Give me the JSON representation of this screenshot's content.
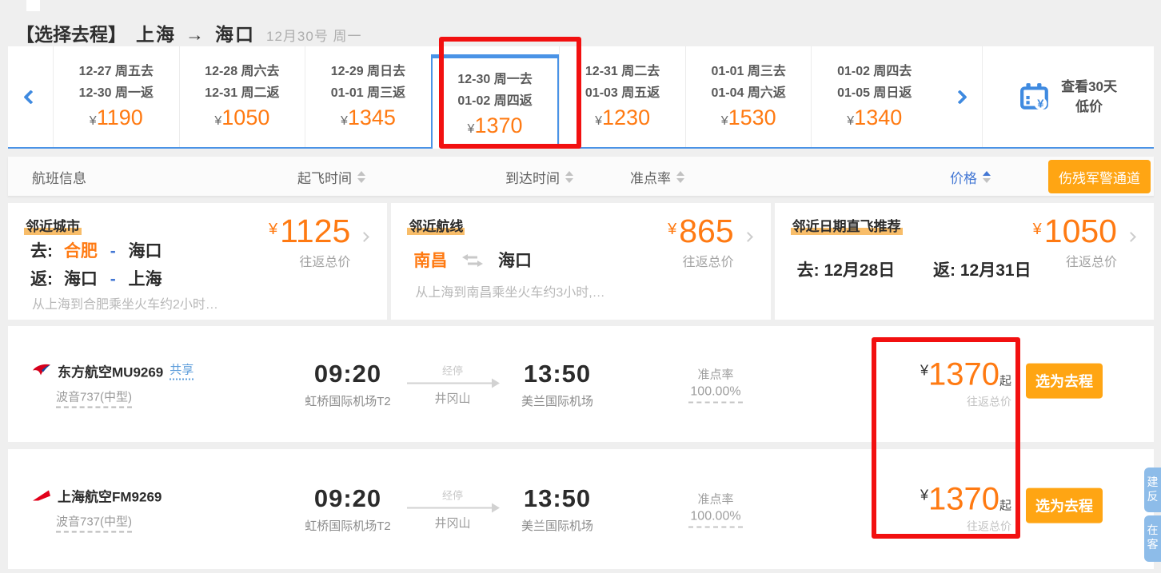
{
  "header": {
    "select_label": "【选择去程】",
    "from_city": "上海",
    "arrow": "→",
    "to_city": "海口",
    "date_info": "12月30号 周一"
  },
  "carousel": {
    "cards": [
      {
        "go": "12-27 周五去",
        "back": "12-30 周一返",
        "yen": "¥",
        "price": "1190"
      },
      {
        "go": "12-28 周六去",
        "back": "12-31 周二返",
        "yen": "¥",
        "price": "1050"
      },
      {
        "go": "12-29 周日去",
        "back": "01-01 周三返",
        "yen": "¥",
        "price": "1345"
      },
      {
        "go": "12-30 周一去",
        "back": "01-02 周四返",
        "yen": "¥",
        "price": "1370",
        "selected": true
      },
      {
        "go": "12-31 周二去",
        "back": "01-03 周五返",
        "yen": "¥",
        "price": "1230"
      },
      {
        "go": "01-01 周三去",
        "back": "01-04 周六返",
        "yen": "¥",
        "price": "1530"
      },
      {
        "go": "01-02 周四去",
        "back": "01-05 周日返",
        "yen": "¥",
        "price": "1340"
      }
    ],
    "view30_line1": "查看30天",
    "view30_line2": "低价"
  },
  "sort_bar": {
    "flight_info": "航班信息",
    "depart": "起飞时间",
    "arrive": "到达时间",
    "ontime": "准点率",
    "price": "价格",
    "military_btn": "伤残军警通道"
  },
  "recommend": {
    "city": {
      "tag": "邻近城市",
      "go_label": "去:",
      "go_city": "合肥",
      "dash1": "-",
      "go_dest": "海口",
      "back_label": "返:",
      "back_from": "海口",
      "dash2": "-",
      "back_to": "上海",
      "note": "从上海到合肥乘坐火车约2小时…",
      "yen": "¥",
      "price": "1125",
      "total": "往返总价"
    },
    "route": {
      "tag": "邻近航线",
      "from": "南昌",
      "to": "海口",
      "note": "从上海到南昌乘坐火车约3小时,…",
      "yen": "¥",
      "price": "865",
      "total": "往返总价"
    },
    "date": {
      "tag": "邻近日期直飞推荐",
      "go": "去: 12月28日",
      "back": "返: 12月31日",
      "yen": "¥",
      "price": "1050",
      "total": "往返总价"
    }
  },
  "flights": [
    {
      "airline": "东方航空MU9269",
      "share": "共享",
      "aircraft": "波音737(中型)",
      "dep_time": "09:20",
      "dep_airport": "虹桥国际机场T2",
      "stop_label": "经停",
      "stop_city": "井冈山",
      "arr_time": "13:50",
      "arr_airport": "美兰国际机场",
      "ontime_label": "准点率",
      "ontime_value": "100.00%",
      "yen": "¥",
      "price": "1370",
      "qi": "起",
      "total": "往返总价",
      "select": "选为去程"
    },
    {
      "airline": "上海航空FM9269",
      "aircraft": "波音737(中型)",
      "dep_time": "09:20",
      "dep_airport": "虹桥国际机场T2",
      "stop_label": "经停",
      "stop_city": "井冈山",
      "arr_time": "13:50",
      "arr_airport": "美兰国际机场",
      "ontime_label": "准点率",
      "ontime_value": "100.00%",
      "yen": "¥",
      "price": "1370",
      "qi": "起",
      "total": "往返总价",
      "select": "选为去程"
    }
  ],
  "side_tabs": {
    "tab1_c1": "建",
    "tab1_c2": "反",
    "tab2_c1": "在",
    "tab2_c2": "客"
  },
  "colors": {
    "price_orange": "#ff7a12",
    "button_orange": "#ffa513",
    "accent_blue": "#4a93e6",
    "annotation_red": "#f21010"
  }
}
